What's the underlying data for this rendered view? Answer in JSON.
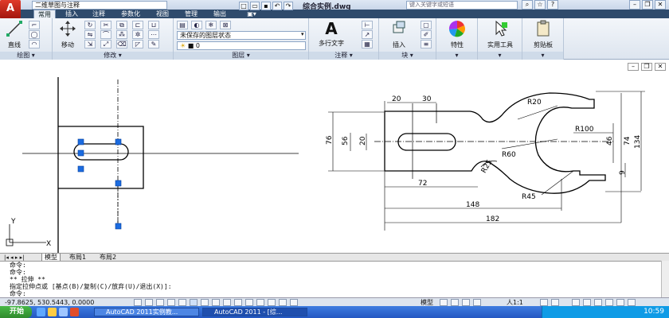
{
  "window": {
    "workspace": "二维草图与注释",
    "file_title": "综合实例.dwg",
    "search_placeholder": "键入关键字或短语"
  },
  "tabs": [
    "常用",
    "插入",
    "注释",
    "参数化",
    "视图",
    "管理",
    "输出"
  ],
  "ribbon": {
    "draw": {
      "title": "绘图",
      "line_label": "直线"
    },
    "modify": {
      "title": "修改",
      "move_label": "移动"
    },
    "layers": {
      "title": "图层",
      "layer_state": "未保存的图层状态",
      "current_layer": "0"
    },
    "annotation": {
      "title": "注释",
      "mtext_label": "多行文字"
    },
    "block": {
      "title": "块",
      "insert_label": "插入"
    },
    "properties": {
      "label": "特性"
    },
    "utilities": {
      "label": "实用工具"
    },
    "clipboard": {
      "label": "剪贴板"
    }
  },
  "drawing": {
    "dims": {
      "d20": "20",
      "d30": "30",
      "r20": "R20",
      "r100": "R100",
      "d76": "76",
      "d56": "56",
      "d20v": "20",
      "r60": "R60",
      "r25": "R25",
      "d46": "46",
      "d74": "74",
      "d134": "134",
      "d9": "9",
      "d72": "72",
      "r45": "R45",
      "d148": "148",
      "d182": "182"
    },
    "ucs": {
      "y": "Y",
      "x": "X"
    }
  },
  "layout_tabs": [
    "模型",
    "布局1",
    "布局2"
  ],
  "command": {
    "lines": [
      "命令:",
      "命令:",
      "** 拉伸 **",
      "指定拉伸点或 [基点(B)/复制(C)/放弃(U)/退出(X)]:",
      "命令:"
    ]
  },
  "status": {
    "coords": "-97.8625,  530.5443, 0.0000",
    "model_label": "模型",
    "scale": "人1:1"
  },
  "taskbar": {
    "start": "开始",
    "tasks": [
      "AutoCAD 2011实例教...",
      "AutoCAD 2011 - [综..."
    ],
    "clock": "10:59"
  }
}
